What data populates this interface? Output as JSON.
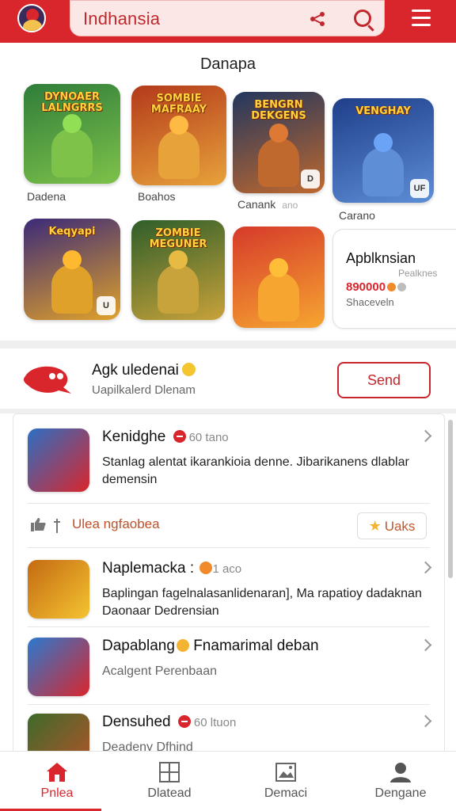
{
  "header": {
    "search_text": "Indhansia"
  },
  "featured": {
    "title": "Danapa",
    "games_row1": [
      {
        "title": "DYNOAER LALNGRRS",
        "label": "Dadena",
        "colors": [
          "#2f7d3a",
          "#7ec24a"
        ]
      },
      {
        "title": "SOMBIE MAFRAAY",
        "label": "Boahos",
        "colors": [
          "#b33a1b",
          "#e8a23a"
        ]
      },
      {
        "title": "BENGRN DEKGENS",
        "label": "Canank",
        "label_suffix": "ano",
        "badge": "D",
        "colors": [
          "#22365e",
          "#c0692e"
        ]
      },
      {
        "title": "VENGHAY",
        "label": "Carano",
        "badge": "UF",
        "colors": [
          "#1f3e8a",
          "#5d8ed6"
        ]
      }
    ],
    "games_row2": [
      {
        "title": "Keqyapi",
        "badge": "U",
        "colors": [
          "#3b2a78",
          "#e0a12b"
        ]
      },
      {
        "title": "ZOMBIE MEGUNER",
        "colors": [
          "#2e5e2a",
          "#c8a23a"
        ]
      },
      {
        "title": "",
        "colors": [
          "#d63a2a",
          "#f6a531"
        ]
      }
    ],
    "app_card": {
      "title": "Apblknsian",
      "sub1": "Pealknes",
      "price": "890000",
      "sub2": "Shaceveln"
    }
  },
  "promo": {
    "title": "Agk uledenai",
    "subtitle": "Uapilkalerd Dlenam",
    "button_label": "Send"
  },
  "feed": {
    "items": [
      {
        "title": "Kenidghe",
        "meta": "60 tano",
        "description": "Stanlag alentat ikarankioia denne. Jibarikanens dlablar demensin",
        "thumb_colors": [
          "#2b6fc4",
          "#d9262c"
        ]
      },
      {
        "title": "Naplemacka :",
        "meta": "1 aco",
        "description": "Baplingan fagelnalasanlidenaran], Ma rapatioy dadaknan Daonaar Dedrensian",
        "thumb_colors": [
          "#c46a12",
          "#f4c431"
        ]
      },
      {
        "title": "Dapablang",
        "title_suffix": "Fnamarimal deban",
        "subtitle": "Acalgent Perenbaan",
        "thumb_colors": [
          "#2a7ad0",
          "#d9262c"
        ]
      },
      {
        "title": "Densuhed",
        "meta": "60 ltuon",
        "subtitle": "Deadeny Dfhind",
        "thumb_colors": [
          "#3d6a2a",
          "#b5532a"
        ]
      }
    ],
    "like_text": "Ulea ngfaobea",
    "star_button_label": "Uaks"
  },
  "nav": {
    "items": [
      {
        "label": "Pnlea",
        "icon": "home-icon",
        "active": true
      },
      {
        "label": "Dlatead",
        "icon": "grid-icon",
        "active": false
      },
      {
        "label": "Demaci",
        "icon": "image-icon",
        "active": false
      },
      {
        "label": "Dengane",
        "icon": "profile-icon",
        "active": false
      }
    ]
  },
  "colors": {
    "brand_red": "#d9262c",
    "divider": "#efefef"
  }
}
